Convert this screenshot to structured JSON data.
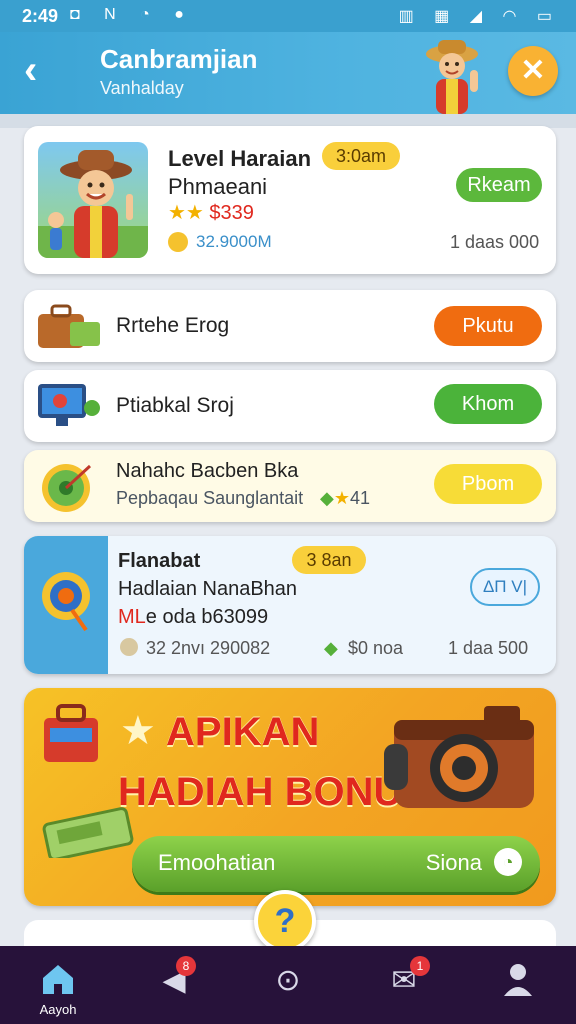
{
  "status_bar": {
    "time": "2:49",
    "left_icons": "◘ N ◔ ●",
    "right_icons": "▥ ▦ ◢ ◠ ▭"
  },
  "header": {
    "back_icon": "chevron-left",
    "title": "Canbramjian",
    "subtitle": "Vanhalday",
    "close_icon": "close"
  },
  "featured": {
    "title": "Level Haraian",
    "badge": "3:0am",
    "subtitle": "Phmaeani",
    "stars": "★★",
    "price": "$339",
    "coin_text": "32.9000M",
    "count": "1 daas 000",
    "button": "Rkeam",
    "button_color": "#5cb83c"
  },
  "rows": [
    {
      "label": "Rrtehe Erog",
      "button": "Pkutu",
      "button_color": "#f06c10",
      "bg": "#ffffff"
    },
    {
      "label": "Ptiabkal Sroj",
      "button": "Khom",
      "button_color": "#4bb33a",
      "bg": "#ffffff"
    },
    {
      "label": "Nahahc Bacben Bka",
      "sub": "Pepbaqau Saunglantait",
      "gems": "41",
      "button": "Pbom",
      "button_color": "#f7dc37",
      "bg": "#fffbe6"
    }
  ],
  "detail": {
    "title": "Flanabat",
    "badge": "3 8an",
    "line2": "Hadlaian NanaBhan",
    "line3_prefix": "ML",
    "line3_rest": "e oda b63099",
    "coin_text": "32 2nvı 290082",
    "gem_text": "$0 noa",
    "count": "1 daa 500",
    "button": "ΔΠ V|"
  },
  "promo": {
    "heading1": "APIKAN",
    "heading2": "HADIAH BONUS",
    "button_left": "Emoohatian",
    "button_right": "Siona"
  },
  "help_icon_text": "?",
  "nav": [
    {
      "label": "Aayoh",
      "icon": "home-icon",
      "badge": ""
    },
    {
      "label": "",
      "icon": "megaphone-icon",
      "badge": "8"
    },
    {
      "label": "",
      "icon": "compass-icon",
      "badge": ""
    },
    {
      "label": "",
      "icon": "mail-icon",
      "badge": "1"
    },
    {
      "label": "",
      "icon": "profile-icon",
      "badge": ""
    }
  ]
}
